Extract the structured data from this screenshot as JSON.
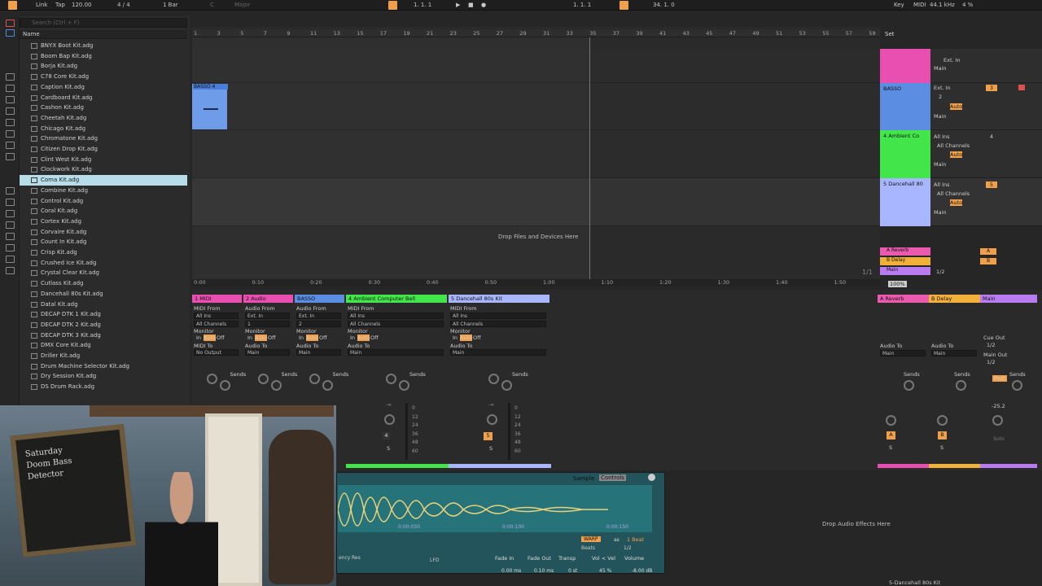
{
  "topbar": {
    "link": "Link",
    "tap": "Tap",
    "tempo": "120.00",
    "sig": "4 / 4",
    "quant": "1 Bar",
    "key_c": "C",
    "scale": "Major",
    "pos": "1.    1.    1",
    "loop_start": "1.    1.    1",
    "loop_len": "34.    1.    0",
    "key_label": "Key",
    "midi": "MIDI",
    "rate": "44.1 kHz",
    "cpu": "4 %"
  },
  "browser": {
    "search_placeholder": "Search (Ctrl + F)",
    "col_name": "Name",
    "items": [
      "BNYX Boot Kit.adg",
      "Boom Bap Kit.adg",
      "Borja Kit.adg",
      "C78 Core Kit.adg",
      "Caption Kit.adg",
      "Cardboard Kit.adg",
      "Cashon Kit.adg",
      "Cheetah Kit.adg",
      "Chicago Kit.adg",
      "Chromatone Kit.adg",
      "Citizen Drop Kit.adg",
      "Clint West Kit.adg",
      "Clockwork Kit.adg",
      "Coma Kit.adg",
      "Combine Kit.adg",
      "Control Kit.adg",
      "Coral Kit.adg",
      "Cortex Kit.adg",
      "Corvaire Kit.adg",
      "Count In Kit.adg",
      "Crisp Kit.adg",
      "Crushed Ice Kit.adg",
      "Crystal Clear Kit.adg",
      "Cutlass Kit.adg",
      "Dancehall 80s Kit.adg",
      "Datal Kit.adg",
      "DECAP DTK 1 Kit.adg",
      "DECAP DTK 2 Kit.adg",
      "DECAP DTK 3 Kit.adg",
      "DMX Core Kit.adg",
      "Driller Kit.adg",
      "Drum Machine Selector Kit.adg",
      "Dry Session Kit.adg",
      "DS Drum Rack.adg"
    ],
    "selected_index": 13
  },
  "ruler": [
    "1",
    "3",
    "5",
    "7",
    "9",
    "11",
    "13",
    "15",
    "17",
    "19",
    "21",
    "23",
    "25",
    "27",
    "29",
    "31",
    "33",
    "35",
    "37",
    "39",
    "41",
    "43",
    "45",
    "47",
    "49",
    "51",
    "53",
    "55",
    "57",
    "59"
  ],
  "set_label": "Set",
  "clip_name": "BASSO 4",
  "drop_files": "Drop Files and Devices Here",
  "timeline": [
    "0:00",
    "0:10",
    "0:20",
    "0:30",
    "0:40",
    "0:50",
    "1:00",
    "1:10",
    "1:20",
    "1:30",
    "1:40",
    "1:50"
  ],
  "tracks": [
    {
      "name": "",
      "color": "#e84fb0",
      "in": "Ext. In",
      "mon": "Auto",
      "out": "Main"
    },
    {
      "name": "BASSO",
      "color": "#5b8de3",
      "in": "Ext. In",
      "ch": "2",
      "mon": "Auto",
      "out": "Main",
      "num": "3"
    },
    {
      "name": "4 Ambient Co",
      "color": "#43e64a",
      "in": "All Ins",
      "ch": "All Channels",
      "mon": "Auto",
      "out": "Main",
      "num": "4"
    },
    {
      "name": "5 Dancehall 80",
      "color": "#a7b6ff",
      "in": "All Ins",
      "ch": "All Channels",
      "mon": "Auto",
      "out": "Main",
      "num": "5"
    }
  ],
  "returns": [
    {
      "name": "A Reverb",
      "color": "#ea5bb0",
      "btn": "A"
    },
    {
      "name": "B Delay",
      "color": "#f0b03a",
      "btn": "B"
    },
    {
      "name": "Main",
      "color": "#b87cf0",
      "btn": ""
    }
  ],
  "ratio": "1/1",
  "zoom": "100%",
  "ratio2": "1/2",
  "mixer": {
    "channels": [
      {
        "name": "1 MIDI",
        "color": "#e84fb0",
        "from": "MIDI From",
        "src": "All Ins",
        "ch": "All Channels",
        "to": "MIDI To",
        "dest": "No Output"
      },
      {
        "name": "2 Audio",
        "color": "#e84fb0",
        "from": "Audio From",
        "src": "Ext. In",
        "ch": "1",
        "to": "Audio To",
        "dest": "Main"
      },
      {
        "name": "BASSO",
        "color": "#5b8de3",
        "from": "Audio From",
        "src": "Ext. In",
        "ch": "2",
        "to": "Audio To",
        "dest": "Main"
      },
      {
        "name": "4 Ambient Computer Bell",
        "color": "#43e64a",
        "from": "MIDI From",
        "src": "All Ins",
        "ch": "All Channels",
        "to": "Audio To",
        "dest": "Main"
      },
      {
        "name": "5 Dancehall 80s Kit",
        "color": "#a7b6ff",
        "from": "MIDI From",
        "src": "All Ins",
        "ch": "All Channels",
        "to": "Audio To",
        "dest": "Main"
      }
    ],
    "monitor": "Monitor",
    "in": "In",
    "auto": "Auto",
    "off": "Off",
    "sends": "Sends",
    "ch4_num": "4",
    "ch5_num": "5",
    "s": "S",
    "inf": "-∞",
    "scale": [
      "0",
      "12",
      "24",
      "36",
      "48",
      "60"
    ],
    "cue_out": "Cue Out",
    "cue_val": "1/2",
    "main_out": "Main Out",
    "main_val": "1/2",
    "main_db": "-25.2",
    "post": "Post",
    "solo": "Solo"
  },
  "device": {
    "tab_sample": "Sample",
    "tab_controls": "Controls",
    "warp": "WARP",
    "as": "as",
    "beat": "1 Beat",
    "beats": "Beats",
    "ratio": "1/2",
    "t1": "0:00:050",
    "t2": "0:00:100",
    "t3": "0:00:150",
    "lfo": "LFO",
    "fade_in": "Fade In",
    "fade_out": "Fade Out",
    "transp": "Transp",
    "vol_vel": "Vol < Vel",
    "volume": "Volume",
    "fi_val": "0.00 ms",
    "fo_val": "0.10 ms",
    "tr_val": "0 st",
    "vv_val": "45 %",
    "vol_val": "-8.00 dB",
    "res": "Res",
    "cy": "ency",
    "drop_fx": "Drop Audio Effects Here",
    "status": "5-Dancehall 80s Kit"
  },
  "webcam": {
    "chalk": "Saturday Doom Bass Detector"
  },
  "colors": {
    "accent": "#f0a04a",
    "selected": "#b6dde8",
    "bg": "#2a2a2a"
  }
}
